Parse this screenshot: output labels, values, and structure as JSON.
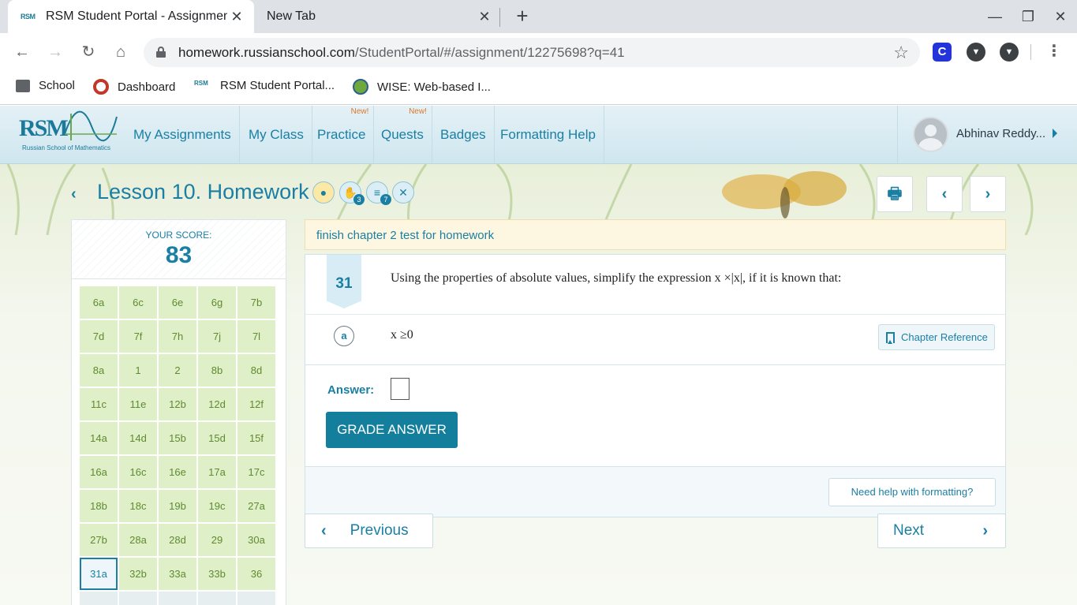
{
  "browser": {
    "tabs": [
      {
        "favicon": "RSM",
        "title": "RSM Student Portal - Assignment",
        "active": true
      },
      {
        "title": "New Tab",
        "active": false
      }
    ],
    "url_host": "homework.russianschool.com",
    "url_path": "/StudentPortal/#/assignment/12275698?q=41",
    "extension_c": "C",
    "bookmarks": [
      {
        "label": "School",
        "icon": "folder-icon"
      },
      {
        "label": "Dashboard",
        "icon": "canvas-icon"
      },
      {
        "label": "RSM Student Portal...",
        "icon": "rsm-icon",
        "favicon": "RSM"
      },
      {
        "label": "WISE: Web-based I...",
        "icon": "wise-icon"
      }
    ]
  },
  "header": {
    "logo_text": "RSM",
    "logo_sub": "Russian School of Mathematics",
    "nav": [
      {
        "label": "My Assignments"
      },
      {
        "label": "My Class"
      },
      {
        "label": "Practice",
        "badge": "New!"
      },
      {
        "label": "Quests",
        "badge": "New!"
      },
      {
        "label": "Badges"
      },
      {
        "label": "Formatting Help"
      }
    ],
    "user_name": "Abhinav Reddy..."
  },
  "lesson": {
    "title": "Lesson 10. Homework",
    "badges": [
      {
        "icon": "medal-icon",
        "count": ""
      },
      {
        "icon": "hand-icon",
        "count": "3"
      },
      {
        "icon": "stack-icon",
        "count": "7"
      },
      {
        "icon": "tools-icon",
        "count": ""
      }
    ]
  },
  "score": {
    "label": "YOUR SCORE:",
    "value": "83",
    "problems": [
      "6a",
      "6c",
      "6e",
      "6g",
      "7b",
      "7d",
      "7f",
      "7h",
      "7j",
      "7l",
      "8a",
      "1",
      "2",
      "8b",
      "8d",
      "11c",
      "11e",
      "12b",
      "12d",
      "12f",
      "14a",
      "14d",
      "15b",
      "15d",
      "15f",
      "16a",
      "16c",
      "16e",
      "17a",
      "17c",
      "18b",
      "18c",
      "19b",
      "19c",
      "27a",
      "27b",
      "28a",
      "28d",
      "29",
      "30a",
      "31a",
      "32b",
      "33a",
      "33b",
      "36"
    ],
    "current": "31a"
  },
  "note": "finish chapter 2 test for homework",
  "problem": {
    "number": "31",
    "text": "Using the properties of absolute values, simplify the expression x ×|x|, if it is known that:",
    "part": "a",
    "condition": "x ≥0",
    "chapter_ref": "Chapter Reference",
    "answer_label": "Answer:",
    "grade_button": "GRADE ANSWER",
    "help_button": "Need help with formatting?"
  },
  "pager": {
    "previous": "Previous",
    "next": "Next"
  }
}
